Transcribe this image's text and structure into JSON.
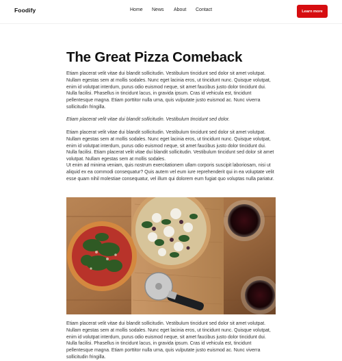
{
  "header": {
    "logo": "Foodify",
    "nav": [
      "Home",
      "News",
      "About",
      "Contact"
    ],
    "cta": "Learn more"
  },
  "article": {
    "title": "The Great Pizza Comeback",
    "paragraphs": [
      "Etiam placerat velit vitae dui blandit sollicitudin. Vestibulum tincidunt sed dolor sit amet volutpat. Nullam egestas sem at mollis sodales. Nunc eget lacinia eros, ut tincidunt nunc. Quisque volutpat, enim id volutpat interdum, purus odio euismod neque, sit amet faucibus justo dolor tincidunt dui. Nulla facilisi. Phasellus in tincidunt lacus, in gravida ipsum. Cras id vehicula est, tincidunt pellentesque magna. Etiam porttitor nulla urna, quis vulputate justo euismod ac. Nunc viverra sollicitudin fringilla.",
      "Etiam placerat velit vitae dui blandit sollicitudin. Vestibulum tincidunt sed dolor.",
      "Etiam placerat velit vitae dui blandit sollicitudin. Vestibulum tincidunt sed dolor sit amet volutpat. Nullam egestas sem at mollis sodales. Nunc eget lacinia eros, ut tincidunt nunc. Quisque volutpat, enim id volutpat interdum, purus odio euismod neque, sit amet faucibus justo dolor tincidunt dui. Nulla facilisi. Etiam placerat velit vitae dui blandit sollicitudin. Vestibulum tincidunt sed dolor sit amet volutpat. Nullam egestas sem at mollis sodales.",
      "Ut enim ad minima veniam, quis nostrum exercitationem ullam corporis suscipit laboriosam, nisi ut aliquid ex ea commodi consequatur? Quis autem vel eum iure reprehenderit qui in ea voluptate velit esse quam nihil molestiae consequatur, vel illum qui dolorem eum fugiat quo voluptas nulla pariatur.",
      "Etiam placerat velit vitae dui blandit sollicitudin. Vestibulum tincidunt sed dolor sit amet volutpat. Nullam egestas sem at mollis sodales. Nunc eget lacinia eros, ut tincidunt nunc. Quisque volutpat, enim id volutpat interdum, purus odio euismod neque, sit amet faucibus justo dolor tincidunt dui. Nulla facilisi. Phasellus in tincidunt lacus, in gravida ipsum. Cras id vehicula est, tincidunt pellentesque magna. Etiam porttitor nulla urna, quis vulputate justo euismod ac. Nunc viverra sollicitudin fringilla."
    ]
  },
  "colors": {
    "accent": "#d60d10",
    "text": "#333333",
    "heading": "#111111"
  }
}
